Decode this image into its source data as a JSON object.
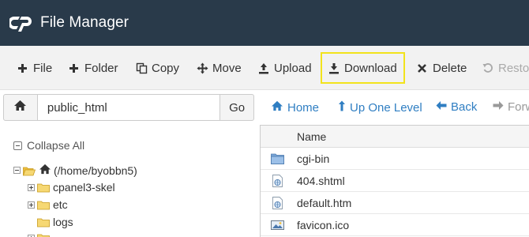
{
  "header": {
    "title": "File Manager"
  },
  "toolbar": {
    "file_label": "File",
    "folder_label": "Folder",
    "copy_label": "Copy",
    "move_label": "Move",
    "upload_label": "Upload",
    "download_label": "Download",
    "delete_label": "Delete",
    "restore_label": "Restore"
  },
  "pathbar": {
    "value": "public_html",
    "go_label": "Go"
  },
  "nav": {
    "home_label": "Home",
    "up_label": "Up One Level",
    "back_label": "Back",
    "forward_label": "Forward"
  },
  "tree": {
    "collapse_label": "Collapse All",
    "root_label": "(/home/byobbn5)",
    "items": [
      "cpanel3-skel",
      "etc",
      "logs"
    ]
  },
  "files": {
    "column_name": "Name",
    "rows": [
      "cgi-bin",
      "404.shtml",
      "default.htm",
      "favicon.ico"
    ]
  },
  "colors": {
    "header_bg": "#293a4a",
    "link": "#2f7ec2",
    "highlight": "#f2e31c"
  }
}
